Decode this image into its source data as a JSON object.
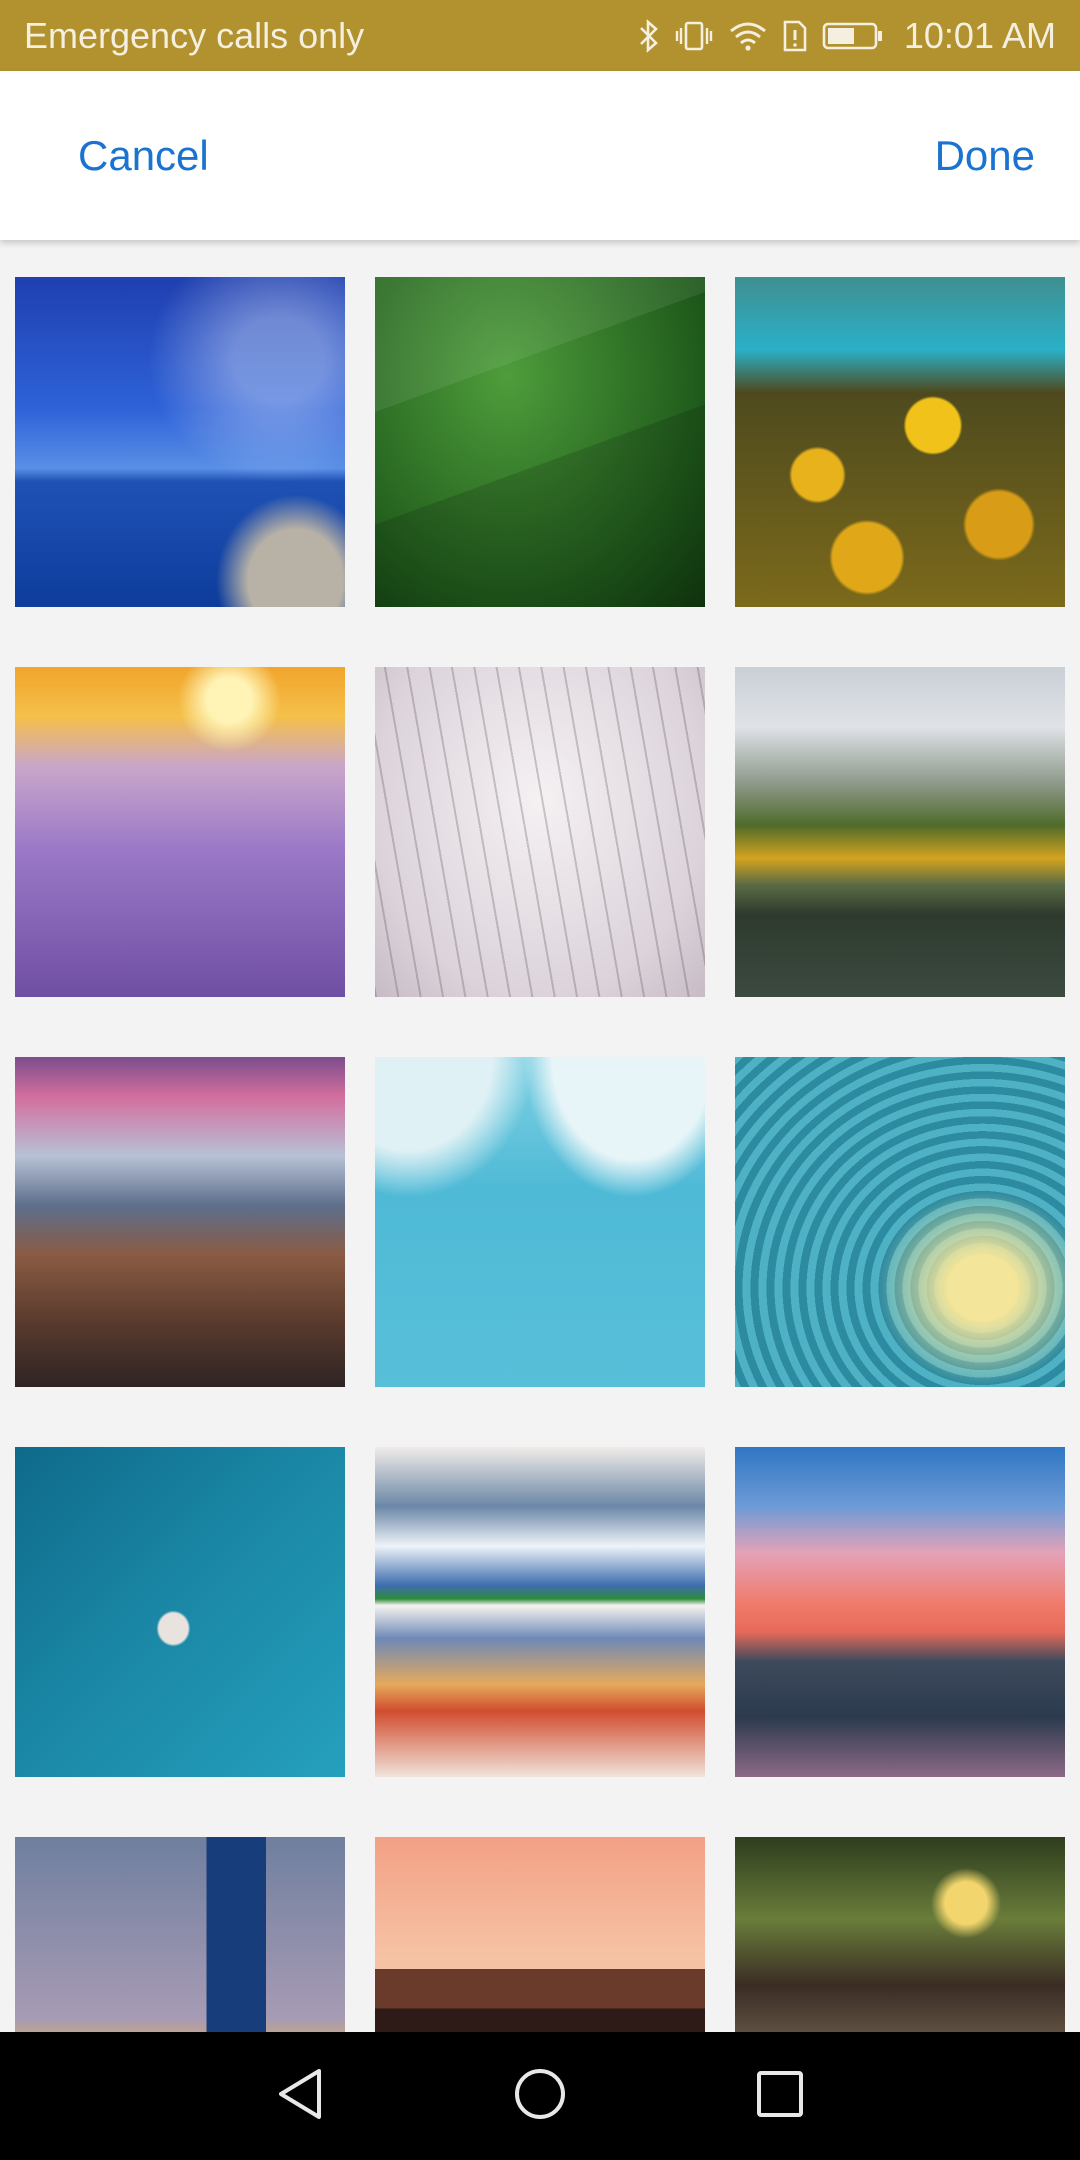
{
  "status_bar": {
    "carrier": "Emergency calls only",
    "time": "10:01 AM",
    "icons": [
      "bluetooth-icon",
      "vibrate-icon",
      "wifi-icon",
      "sim-alert-icon",
      "battery-icon"
    ]
  },
  "action_bar": {
    "cancel_label": "Cancel",
    "done_label": "Done"
  },
  "thumbnails": [
    "starry-night-ocean",
    "green-field",
    "autumn-forest-river",
    "lavender-sunset",
    "snowy-trees",
    "mountain-lake-reflection",
    "waterfall-cliffs",
    "glacier-ice",
    "ocean-wave-tube",
    "boat-aerial",
    "snow-mountain-lake",
    "sunset-mountains",
    "city-skyline",
    "pier-house-sunset",
    "village-street-night"
  ],
  "nav_bar": {
    "icons": [
      "back-icon",
      "home-icon",
      "recent-apps-icon"
    ]
  }
}
